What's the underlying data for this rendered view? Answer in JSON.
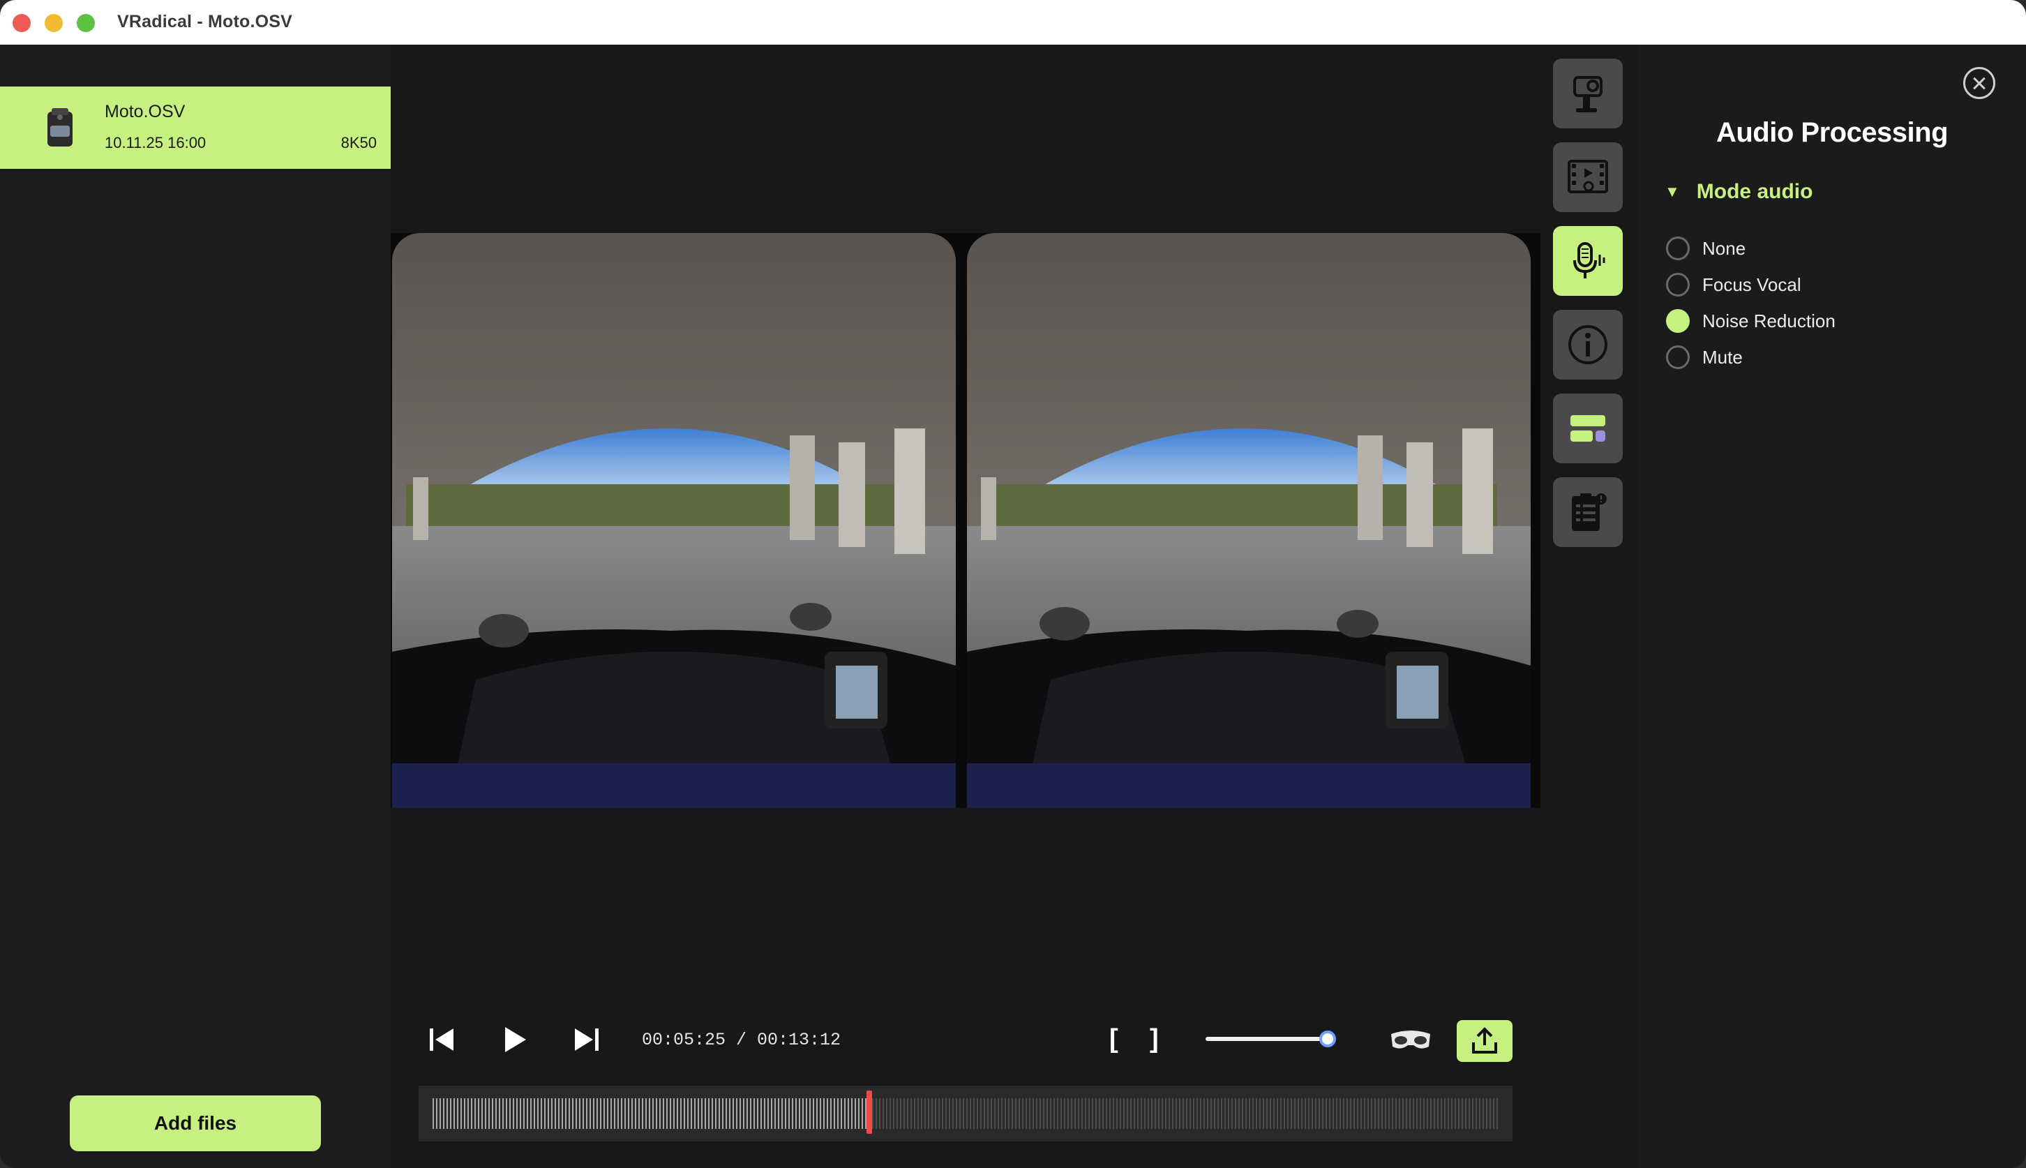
{
  "window": {
    "title": "VRadical - Moto.OSV"
  },
  "sidebar": {
    "files": [
      {
        "name": "Moto.OSV",
        "date": "10.11.25 16:00",
        "resolution": "8K50",
        "selected": true,
        "icon": "camera-icon"
      }
    ],
    "add_files_label": "Add files"
  },
  "toolbar": {
    "tools": [
      {
        "name": "camera-settings",
        "icon": "camera-gimbal-icon",
        "active": false
      },
      {
        "name": "video-settings",
        "icon": "film-gear-icon",
        "active": false
      },
      {
        "name": "audio-processing",
        "icon": "microphone-icon",
        "active": true
      },
      {
        "name": "info",
        "icon": "info-icon",
        "active": false
      },
      {
        "name": "layout",
        "icon": "layout-blocks-icon",
        "active": false
      },
      {
        "name": "task-list",
        "icon": "clipboard-list-icon",
        "active": false
      }
    ]
  },
  "panel": {
    "title": "Audio Processing",
    "section": "Mode audio",
    "options": [
      {
        "label": "None",
        "checked": false
      },
      {
        "label": "Focus Vocal",
        "checked": false
      },
      {
        "label": "Noise Reduction",
        "checked": true
      },
      {
        "label": "Mute",
        "checked": false
      }
    ]
  },
  "player": {
    "current_time": "00:05:25",
    "total_time": "00:13:12",
    "time_display": "00:05:25 / 00:13:12",
    "in_mark": "[",
    "out_mark": "]",
    "volume": 0.95,
    "progress": 0.41,
    "icons": [
      "skip-back-icon",
      "play-icon",
      "skip-forward-icon",
      "vr-headset-icon",
      "export-icon"
    ]
  },
  "colors": {
    "accent": "#c6f181",
    "background": "#191919",
    "panel": "#1b1b1b",
    "tool_inactive": "#4a4a4a",
    "playhead": "#f04a4a",
    "volume_knob_border": "#6fa0ff"
  }
}
